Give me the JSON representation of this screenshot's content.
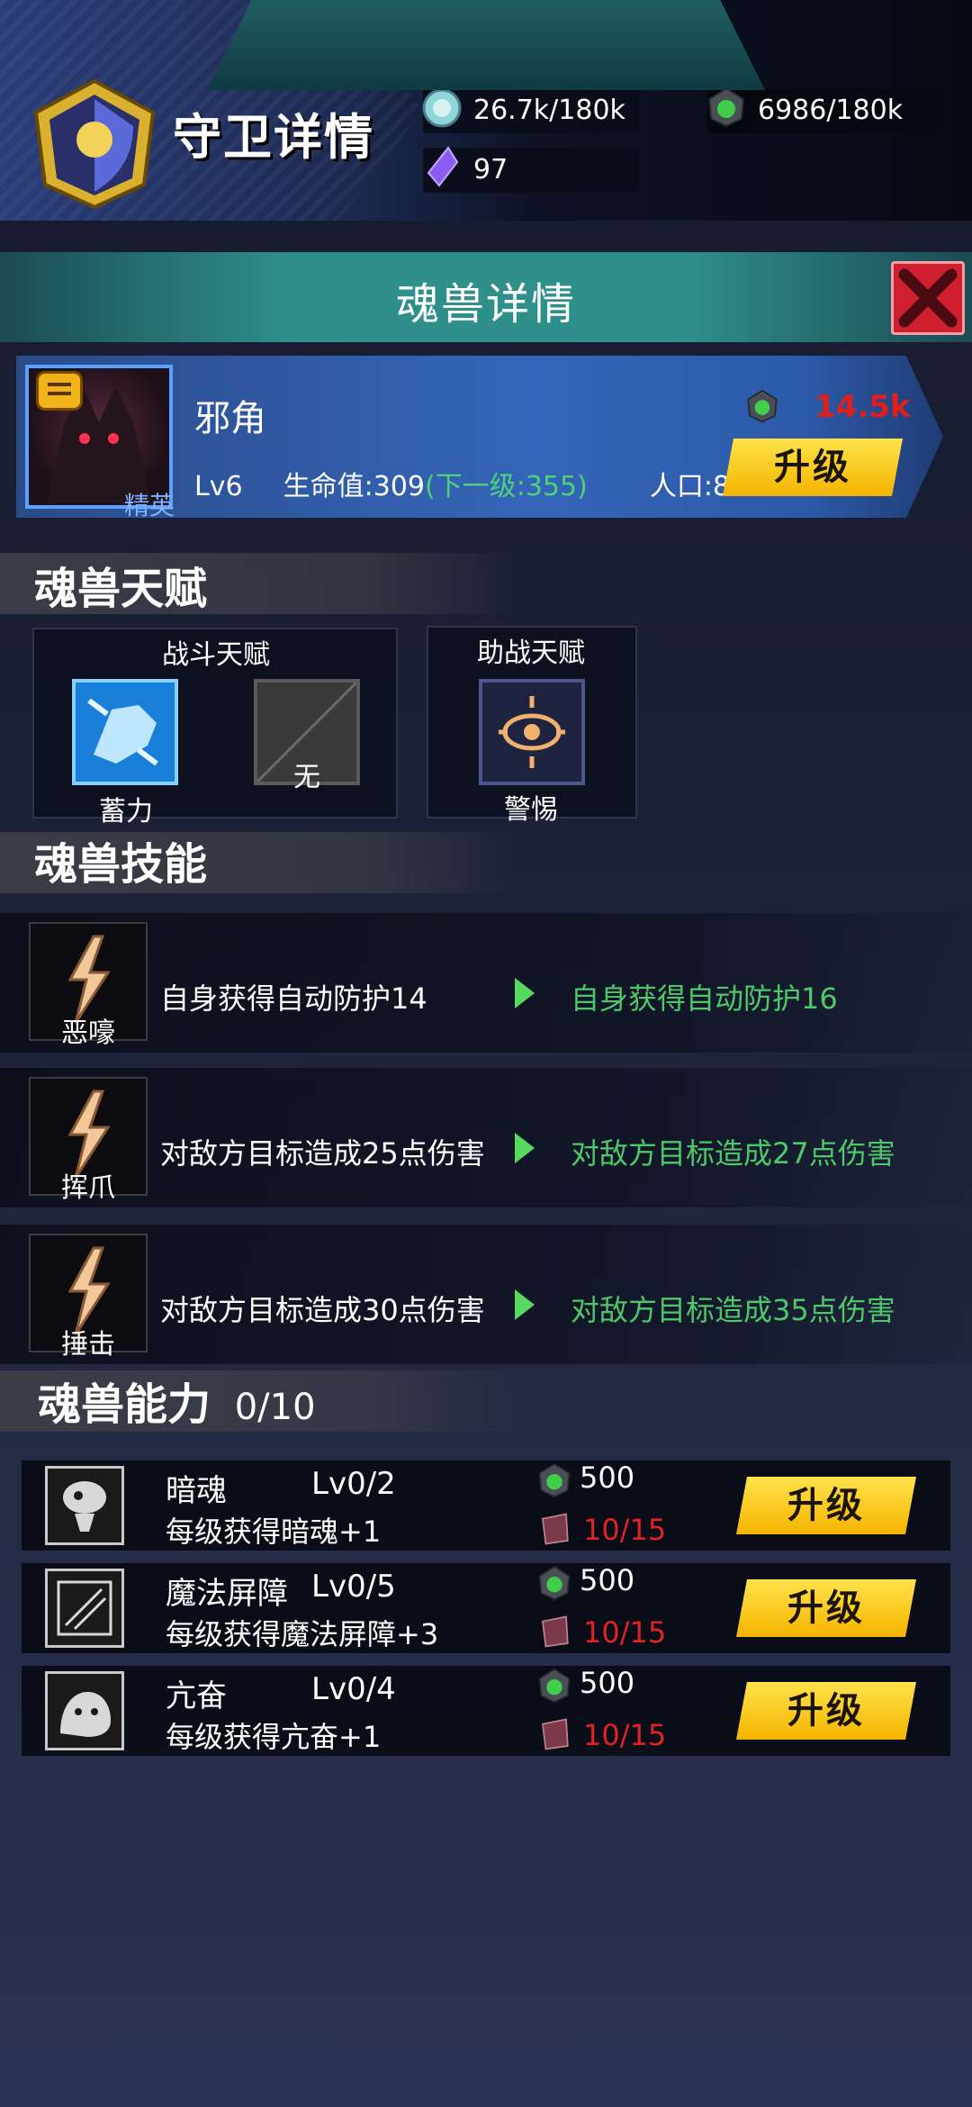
{
  "header": {
    "title": "守卫详情",
    "resources": {
      "crystal": "26.7k/180k",
      "green_gem": "6986/180k",
      "purple": "97"
    }
  },
  "detail": {
    "title": "魂兽详情",
    "close_icon": "close-x-icon"
  },
  "beast": {
    "name": "邪角",
    "rank": "精英",
    "level": "Lv6",
    "hp": "生命值:309",
    "hp_next": "(下一级:355)",
    "population": "人口:80",
    "upgrade_cost": "14.5k",
    "upgrade_label": "升级"
  },
  "talents": {
    "section_title": "魂兽天赋",
    "battle": {
      "title": "战斗天赋",
      "items": [
        {
          "label": "蓄力",
          "icon": "fist-icon"
        },
        {
          "label": "无",
          "icon": "empty-slot-icon"
        }
      ]
    },
    "assist": {
      "title": "助战天赋",
      "items": [
        {
          "label": "警惕",
          "icon": "eye-icon"
        }
      ]
    }
  },
  "skills": {
    "section_title": "魂兽技能",
    "items": [
      {
        "name": "恶嚎",
        "current": "自身获得自动防护14",
        "next": "自身获得自动防护16"
      },
      {
        "name": "挥爪",
        "current": "对敌方目标造成25点伤害",
        "next": "对敌方目标造成27点伤害"
      },
      {
        "name": "捶击",
        "current": "对敌方目标造成30点伤害",
        "next": "对敌方目标造成35点伤害"
      }
    ]
  },
  "abilities": {
    "section_title": "魂兽能力",
    "count": "0/10",
    "items": [
      {
        "name": "暗魂",
        "level": "Lv0/2",
        "desc": "每级获得暗魂+1",
        "cost_gem": "500",
        "cost_mat": "10/15",
        "upgrade_label": "升级"
      },
      {
        "name": "魔法屏障",
        "level": "Lv0/5",
        "desc": "每级获得魔法屏障+3",
        "cost_gem": "500",
        "cost_mat": "10/15",
        "upgrade_label": "升级"
      },
      {
        "name": "亢奋",
        "level": "Lv0/4",
        "desc": "每级获得亢奋+1",
        "cost_gem": "500",
        "cost_mat": "10/15",
        "upgrade_label": "升级"
      }
    ]
  },
  "colors": {
    "accent_green": "#4fd07a",
    "accent_red": "#e02323",
    "button_yellow": "#f5b400"
  }
}
